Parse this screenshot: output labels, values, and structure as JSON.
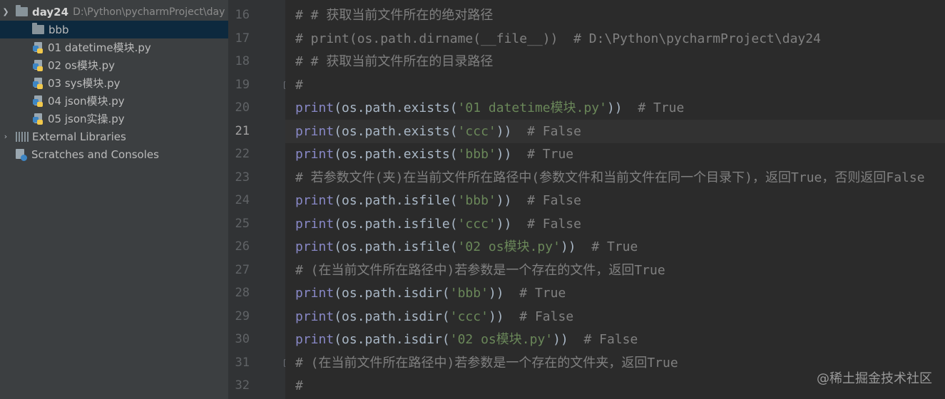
{
  "project_tree": {
    "project": {
      "name": "day24",
      "path": "D:\\Python\\pycharmProject\\day"
    },
    "items": [
      {
        "label": "bbb",
        "icon": "folder-icon",
        "selected": true
      },
      {
        "label": "01 datetime模块.py",
        "icon": "python-file-icon"
      },
      {
        "label": "02 os模块.py",
        "icon": "python-file-icon"
      },
      {
        "label": "03 sys模块.py",
        "icon": "python-file-icon"
      },
      {
        "label": "04 json模块.py",
        "icon": "python-file-icon"
      },
      {
        "label": "05 json实操.py",
        "icon": "python-file-icon"
      }
    ],
    "external_libraries": "External Libraries",
    "scratches": "Scratches and Consoles"
  },
  "editor": {
    "current_line": 21,
    "lines": [
      {
        "num": "16",
        "tokens": [
          {
            "t": "# # 获取当前文件所在的绝对路径",
            "c": "cmt"
          }
        ]
      },
      {
        "num": "17",
        "tokens": [
          {
            "t": "# print(os.path.dirname(__file__))  # D:\\Python\\pycharmProject\\day24",
            "c": "cmt"
          }
        ]
      },
      {
        "num": "18",
        "tokens": [
          {
            "t": "# # 获取当前文件所在的目录路径",
            "c": "cmt"
          }
        ]
      },
      {
        "num": "19",
        "tokens": [
          {
            "t": "#",
            "c": "cmt"
          }
        ],
        "fold": true
      },
      {
        "num": "20",
        "tokens": [
          {
            "t": "print",
            "c": "fn"
          },
          {
            "t": "(os.path.exists(",
            "c": ""
          },
          {
            "t": "'01 datetime模块.py'",
            "c": "str"
          },
          {
            "t": "))  ",
            "c": ""
          },
          {
            "t": "# True",
            "c": "cmt"
          }
        ]
      },
      {
        "num": "21",
        "tokens": [
          {
            "t": "print",
            "c": "fn"
          },
          {
            "t": "(os.path.exists(",
            "c": ""
          },
          {
            "t": "'ccc'",
            "c": "str"
          },
          {
            "t": "))  ",
            "c": ""
          },
          {
            "t": "# False",
            "c": "cmt"
          }
        ]
      },
      {
        "num": "22",
        "tokens": [
          {
            "t": "print",
            "c": "fn"
          },
          {
            "t": "(os.path.exists(",
            "c": ""
          },
          {
            "t": "'bbb'",
            "c": "str"
          },
          {
            "t": "))  ",
            "c": ""
          },
          {
            "t": "# True",
            "c": "cmt"
          }
        ]
      },
      {
        "num": "23",
        "tokens": [
          {
            "t": "# 若参数文件(夹)在当前文件所在路径中(参数文件和当前文件在同一个目录下)，返回True，否则返回False",
            "c": "cmt"
          }
        ]
      },
      {
        "num": "24",
        "tokens": [
          {
            "t": "print",
            "c": "fn"
          },
          {
            "t": "(os.path.isfile(",
            "c": ""
          },
          {
            "t": "'bbb'",
            "c": "str"
          },
          {
            "t": "))  ",
            "c": ""
          },
          {
            "t": "# False",
            "c": "cmt"
          }
        ]
      },
      {
        "num": "25",
        "tokens": [
          {
            "t": "print",
            "c": "fn"
          },
          {
            "t": "(os.path.isfile(",
            "c": ""
          },
          {
            "t": "'ccc'",
            "c": "str"
          },
          {
            "t": "))  ",
            "c": ""
          },
          {
            "t": "# False",
            "c": "cmt"
          }
        ]
      },
      {
        "num": "26",
        "tokens": [
          {
            "t": "print",
            "c": "fn"
          },
          {
            "t": "(os.path.isfile(",
            "c": ""
          },
          {
            "t": "'02 os模块.py'",
            "c": "str"
          },
          {
            "t": "))  ",
            "c": ""
          },
          {
            "t": "# True",
            "c": "cmt"
          }
        ]
      },
      {
        "num": "27",
        "tokens": [
          {
            "t": "# (在当前文件所在路径中)若参数是一个存在的文件，返回True",
            "c": "cmt"
          }
        ]
      },
      {
        "num": "28",
        "tokens": [
          {
            "t": "print",
            "c": "fn"
          },
          {
            "t": "(os.path.isdir(",
            "c": ""
          },
          {
            "t": "'bbb'",
            "c": "str"
          },
          {
            "t": "))  ",
            "c": ""
          },
          {
            "t": "# True",
            "c": "cmt"
          }
        ]
      },
      {
        "num": "29",
        "tokens": [
          {
            "t": "print",
            "c": "fn"
          },
          {
            "t": "(os.path.isdir(",
            "c": ""
          },
          {
            "t": "'ccc'",
            "c": "str"
          },
          {
            "t": "))  ",
            "c": ""
          },
          {
            "t": "# False",
            "c": "cmt"
          }
        ]
      },
      {
        "num": "30",
        "tokens": [
          {
            "t": "print",
            "c": "fn"
          },
          {
            "t": "(os.path.isdir(",
            "c": ""
          },
          {
            "t": "'02 os模块.py'",
            "c": "str"
          },
          {
            "t": "))  ",
            "c": ""
          },
          {
            "t": "# False",
            "c": "cmt"
          }
        ]
      },
      {
        "num": "31",
        "tokens": [
          {
            "t": "# (在当前文件所在路径中)若参数是一个存在的文件夹，返回True",
            "c": "cmt"
          }
        ],
        "fold": true
      },
      {
        "num": "32",
        "tokens": [
          {
            "t": "#",
            "c": "cmt"
          }
        ]
      }
    ]
  },
  "watermark": "@稀土掘金技术社区",
  "colors": {
    "keyword_builtin": "#8888c6",
    "string": "#6a8759",
    "comment": "#808080",
    "default_code": "#a9b7c6",
    "selection": "#0d293e"
  }
}
